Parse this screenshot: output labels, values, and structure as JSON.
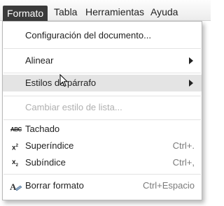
{
  "menubar": {
    "items": [
      {
        "label": "Formato",
        "active": true
      },
      {
        "label": "Tabla"
      },
      {
        "label": "Herramientas"
      },
      {
        "label": "Ayuda"
      }
    ]
  },
  "menu": {
    "document_settings": "Configuración del documento...",
    "align": "Alinear",
    "paragraph_styles": "Estilos de párrafo",
    "change_list_style": "Cambiar estilo de lista...",
    "strikethrough": "Tachado",
    "superscript": "Superíndice",
    "superscript_shortcut": "Ctrl+.",
    "subscript": "Subíndice",
    "subscript_shortcut": "Ctrl+,",
    "clear_format": "Borrar formato",
    "clear_format_shortcut": "Ctrl+Espacio"
  },
  "icons": {
    "strikethrough": "strikethrough-abc-icon",
    "superscript": "superscript-icon",
    "subscript": "subscript-icon",
    "clear_format": "clear-format-icon"
  }
}
